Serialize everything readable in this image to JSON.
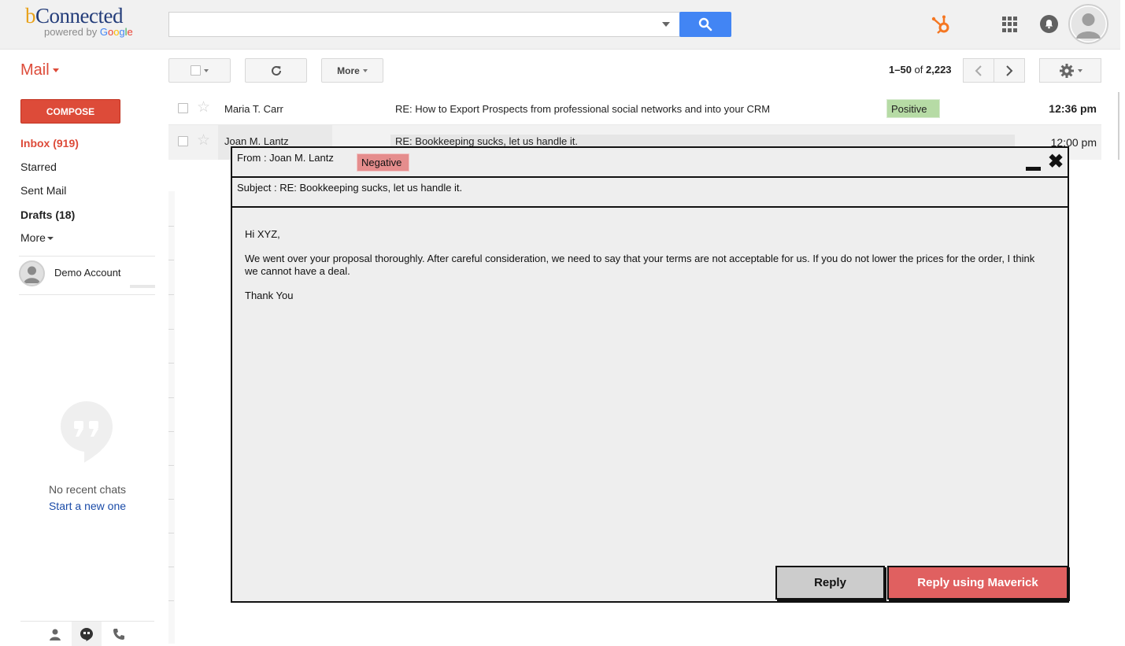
{
  "brand": {
    "name_b": "b",
    "name_rest": "Connected",
    "powered_by": "powered by ",
    "google_letters": [
      "G",
      "o",
      "o",
      "g",
      "l",
      "e"
    ]
  },
  "header": {
    "search_placeholder": "",
    "icons": [
      "search-icon",
      "hubspot-icon",
      "apps-grid-icon",
      "notifications-icon",
      "avatar"
    ]
  },
  "toolbar": {
    "mail_label": "Mail",
    "more_label": "More",
    "pager": {
      "range": "1–50",
      "of": " of ",
      "total": "2,223"
    }
  },
  "sidebar": {
    "compose_label": "COMPOSE",
    "items": [
      {
        "label": "Inbox (919)"
      },
      {
        "label": "Starred"
      },
      {
        "label": "Sent Mail"
      },
      {
        "label": "Drafts (18)"
      },
      {
        "label": "More"
      }
    ],
    "account_name": "Demo Account",
    "no_recent_chats": "No recent chats",
    "start_new": "Start a new one"
  },
  "mail_list": [
    {
      "sender": "Maria T. Carr",
      "subject": "RE: How to Export Prospects from professional social networks and into your CRM",
      "sentiment": "Positive",
      "time": "12:36 pm"
    },
    {
      "sender": "Joan M. Lantz",
      "subject": "RE:  Bookkeeping sucks, let us handle it.",
      "time": "12:00 pm"
    }
  ],
  "popup": {
    "from": "From : Joan M. Lantz",
    "sentiment": "Negative",
    "subject": "Subject : RE:  Bookkeeping sucks, let us handle it.",
    "body": [
      "Hi XYZ,",
      "We went over your proposal thoroughly. After careful consideration, we need to say that your terms are not acceptable for us. If you do not lower the prices for the order, I think we cannot have a deal.",
      "Thank You"
    ],
    "reply_label": "Reply",
    "reply_maverick_label": "Reply using Maverick"
  },
  "colors": {
    "accent_red": "#dd4b39",
    "search_blue": "#4285f4",
    "positive": "#b6dba5",
    "negative": "#e58d8d",
    "maverick": "#e06060"
  }
}
